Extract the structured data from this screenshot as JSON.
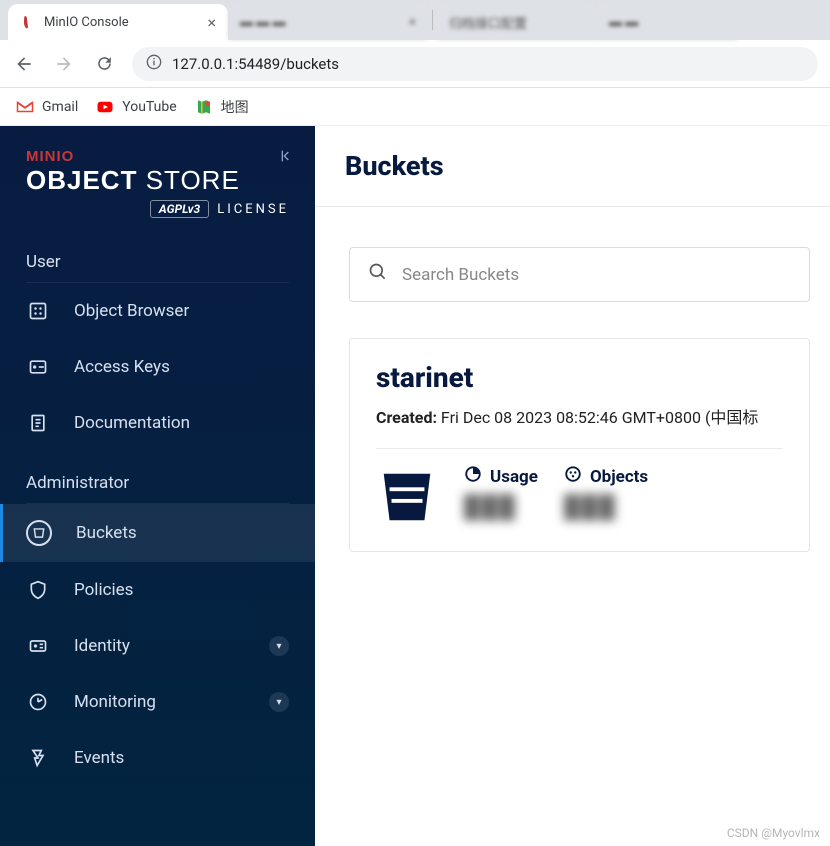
{
  "browser": {
    "active_tab_title": "MinIO Console",
    "inactive_tab_title": "归档接口配置",
    "url_display": "127.0.0.1:54489/buckets",
    "bookmarks": [
      {
        "label": "Gmail",
        "icon": "gmail-icon"
      },
      {
        "label": "YouTube",
        "icon": "youtube-icon"
      },
      {
        "label": "地图",
        "icon": "maps-icon"
      }
    ]
  },
  "sidebar": {
    "logo_brand": "MINIO",
    "logo_line2_bold": "OBJECT",
    "logo_line2_rest": "STORE",
    "logo_badge": "AGPLv3",
    "logo_license": "LICENSE",
    "sections": {
      "user": {
        "title": "User",
        "items": [
          {
            "label": "Object Browser",
            "icon": "object-browser-icon"
          },
          {
            "label": "Access Keys",
            "icon": "access-keys-icon"
          },
          {
            "label": "Documentation",
            "icon": "documentation-icon"
          }
        ]
      },
      "admin": {
        "title": "Administrator",
        "items": [
          {
            "label": "Buckets",
            "icon": "bucket-icon",
            "active": true
          },
          {
            "label": "Policies",
            "icon": "policies-icon"
          },
          {
            "label": "Identity",
            "icon": "identity-icon",
            "chevron": true
          },
          {
            "label": "Monitoring",
            "icon": "monitoring-icon",
            "chevron": true
          },
          {
            "label": "Events",
            "icon": "events-icon"
          }
        ]
      }
    }
  },
  "main": {
    "title": "Buckets",
    "search_placeholder": "Search Buckets",
    "bucket": {
      "name": "starinet",
      "created_label": "Created:",
      "created_value": "Fri Dec 08 2023 08:52:46 GMT+0800 (中国标",
      "usage_label": "Usage",
      "usage_value": "███",
      "objects_label": "Objects",
      "objects_value": "███"
    }
  },
  "watermark": "CSDN @Myovlmx"
}
